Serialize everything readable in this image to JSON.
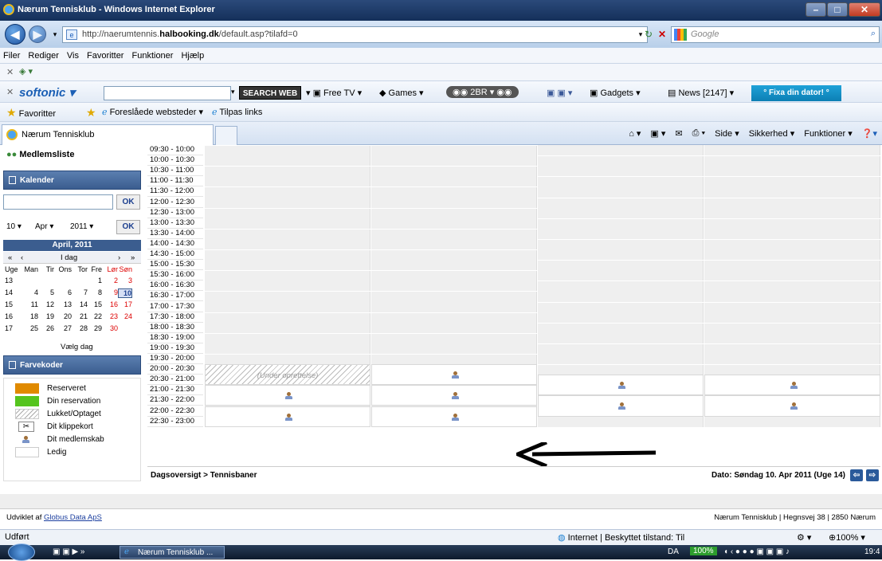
{
  "window": {
    "title": "Nærum Tennisklub - Windows Internet Explorer"
  },
  "address": {
    "prefix": "http://naerumtennis.",
    "host": "halbooking.dk",
    "path": "/default.asp?tilafd=0"
  },
  "search": {
    "placeholder": "Google"
  },
  "menu": [
    "Filer",
    "Rediger",
    "Vis",
    "Favoritter",
    "Funktioner",
    "Hjælp"
  ],
  "toolbar": {
    "brand": "softonic",
    "search_web": "SEARCH WEB",
    "free_tv": "Free TV",
    "games": "Games",
    "radio": "2BR",
    "gadgets": "Gadgets",
    "news": "News [2147]",
    "fixa": "° Fixa din dator! °"
  },
  "favorites": {
    "label": "Favoritter",
    "suggested": "Foreslåede websteder",
    "links": "Tilpas links"
  },
  "tab": {
    "label": "Nærum Tennisklub"
  },
  "commands": [
    "Side",
    "Sikkerhed",
    "Funktioner"
  ],
  "sidebar": {
    "member_list": "Medlemsliste",
    "calendar": "Kalender",
    "ok": "OK",
    "day": "10",
    "month": "Apr",
    "year": "2011",
    "month_title": "April, 2011",
    "today": "I dag",
    "nav_prev2": "«",
    "nav_prev": "‹",
    "nav_next": "›",
    "nav_next2": "»",
    "headers": [
      "Uge",
      "Man",
      "Tir",
      "Ons",
      "Tor",
      "Fre",
      "Lør",
      "Søn"
    ],
    "weeks": [
      [
        "13",
        "",
        "",
        "",
        "",
        "1",
        "2",
        "3"
      ],
      [
        "14",
        "4",
        "5",
        "6",
        "7",
        "8",
        "9",
        "10"
      ],
      [
        "15",
        "11",
        "12",
        "13",
        "14",
        "15",
        "16",
        "17"
      ],
      [
        "16",
        "18",
        "19",
        "20",
        "21",
        "22",
        "23",
        "24"
      ],
      [
        "17",
        "25",
        "26",
        "27",
        "28",
        "29",
        "30",
        ""
      ]
    ],
    "choose_day": "Vælg dag",
    "color_codes": "Farvekoder",
    "legend": [
      {
        "label": "Reserveret",
        "color": "#e08a00"
      },
      {
        "label": "Din reservation",
        "color": "#55c41e"
      },
      {
        "label": "Lukket/Optaget",
        "color": "hatch"
      },
      {
        "label": "Dit klippekort",
        "color": "scissors"
      },
      {
        "label": "Dit medlemskab",
        "color": "person"
      },
      {
        "label": "Ledig",
        "color": "#ffffff"
      }
    ]
  },
  "schedule": {
    "times": [
      "09:30 - 10:00",
      "10:00 - 10:30",
      "10:30 - 11:00",
      "11:00 - 11:30",
      "11:30 - 12:00",
      "12:00 - 12:30",
      "12:30 - 13:00",
      "13:00 - 13:30",
      "13:30 - 14:00",
      "14:00 - 14:30",
      "14:30 - 15:00",
      "15:00 - 15:30",
      "15:30 - 16:00",
      "16:00 - 16:30",
      "16:30 - 17:00",
      "17:00 - 17:30",
      "17:30 - 18:00",
      "18:00 - 18:30",
      "18:30 - 19:00",
      "19:00 - 19:30",
      "19:30 - 20:00",
      "20:00 - 20:30",
      "20:30 - 21:00",
      "21:00 - 21:30",
      "21:30 - 22:00",
      "22:00 - 22:30",
      "22:30 - 23:00"
    ],
    "under_construction": "(Under oprettelse)",
    "breadcrumb": "Dagsoversigt > Tennisbaner",
    "date": "Dato: Søndag 10. Apr 2011 (Uge 14)"
  },
  "footer": {
    "developed_by": "Udviklet af",
    "company": "Globus Data ApS",
    "club": "Nærum Tennisklub | Hegnsvej 38 | 2850 Nærum"
  },
  "status": {
    "done": "Udført",
    "zone": "Internet | Beskyttet tilstand: Til",
    "zoom": "100%"
  },
  "taskbar": {
    "task": "Nærum Tennisklub ...",
    "lang": "DA",
    "zoom": "100%",
    "clock": "19:4"
  }
}
